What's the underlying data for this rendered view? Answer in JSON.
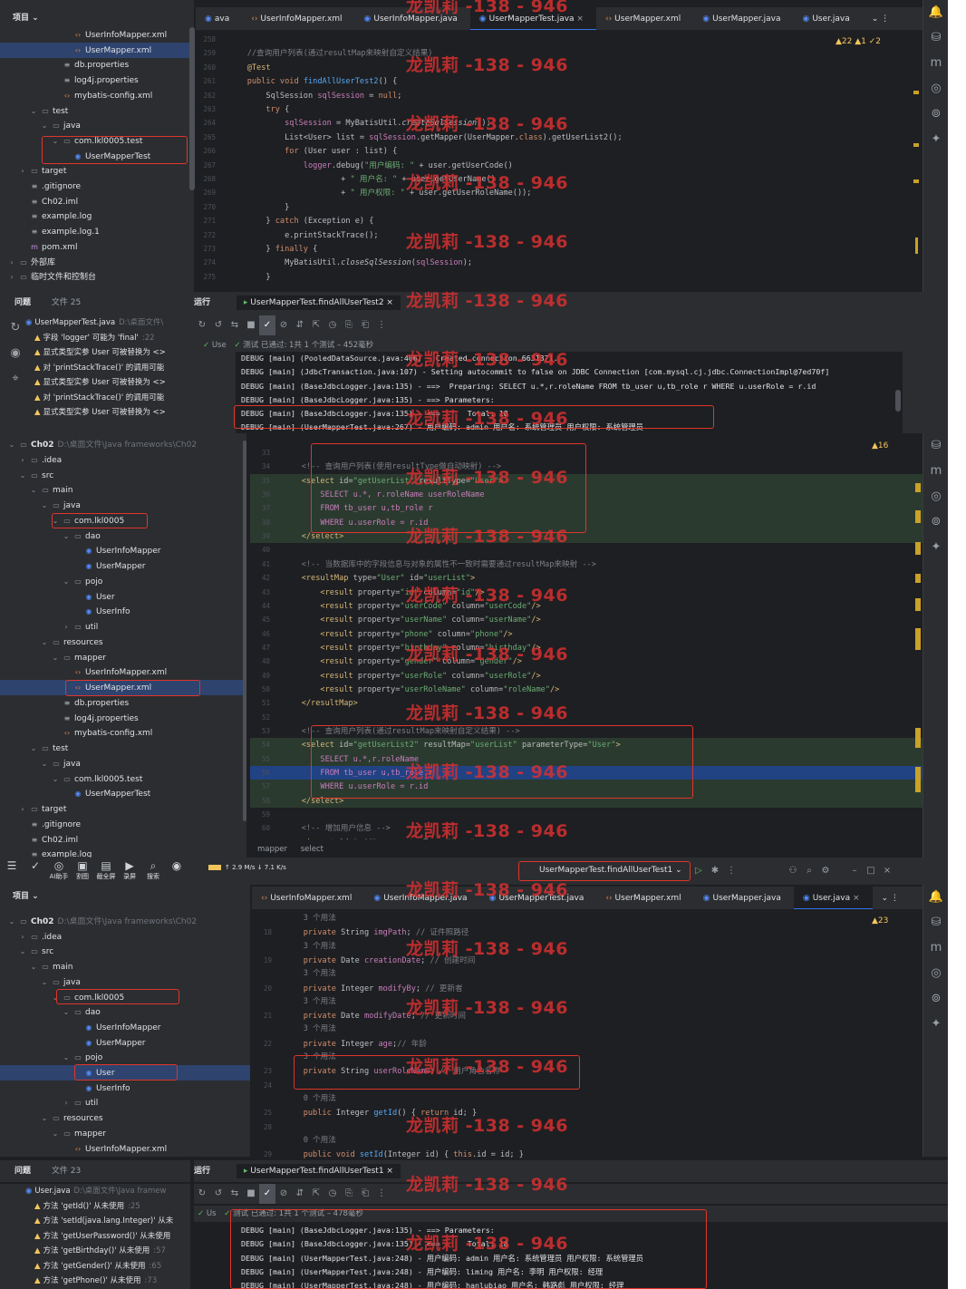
{
  "watermark": "龙凯莉 -138 - 946",
  "warnings_count_a": "▲22 ▲1 ✓2",
  "warnings_count_b": "▲16",
  "warnings_count_c": "▲23",
  "shot1": {
    "tree": [
      {
        "t": "UserInfoMapper.xml",
        "i": "xml",
        "d": 5
      },
      {
        "t": "UserMapper.xml",
        "i": "xml",
        "d": 5,
        "sel": true
      },
      {
        "t": "db.properties",
        "i": "prop",
        "d": 4
      },
      {
        "t": "log4j.properties",
        "i": "prop",
        "d": 4
      },
      {
        "t": "mybatis-config.xml",
        "i": "xml",
        "d": 4
      },
      {
        "t": "test",
        "i": "fold",
        "d": 2,
        "arrow": "v"
      },
      {
        "t": "java",
        "i": "fold",
        "d": 3,
        "arrow": "v"
      },
      {
        "t": "com.lkl0005.test",
        "i": "fold",
        "d": 4,
        "arrow": "v"
      },
      {
        "t": "UserMapperTest",
        "i": "java",
        "d": 5
      },
      {
        "t": "target",
        "i": "fold",
        "d": 1,
        "arrow": ">"
      },
      {
        "t": ".gitignore",
        "i": "prop",
        "d": 1
      },
      {
        "t": "Ch02.iml",
        "i": "prop",
        "d": 1
      },
      {
        "t": "example.log",
        "i": "prop",
        "d": 1
      },
      {
        "t": "example.log.1",
        "i": "prop",
        "d": 1
      },
      {
        "t": "pom.xml",
        "i": "mod",
        "d": 1
      },
      {
        "t": "外部库",
        "i": "fold",
        "d": 0,
        "arrow": ">"
      },
      {
        "t": "临时文件和控制台",
        "i": "fold",
        "d": 0,
        "arrow": ">"
      }
    ],
    "tabs": [
      "ava",
      "UserInfoMapper.xml",
      "UserInfoMapper.java",
      "UserMapperTest.java",
      "UserMapper.xml",
      "UserMapper.java",
      "User.java"
    ],
    "active_tab": 3,
    "code": [
      {
        "n": "258",
        "h": ""
      },
      {
        "n": "259",
        "h": "    <span class='cm'>//查询用户列表(通过resultMap来映射自定义结果)</span>"
      },
      {
        "n": "260",
        "h": "    <span class='tagc'>@Test</span>"
      },
      {
        "n": "261",
        "h": "    <span class='kw'>public void</span> <span class='fn'>findAllUserTest2</span>() {"
      },
      {
        "n": "262",
        "h": "        SqlSession <span class='pu'>sqlSession</span> = <span class='kw'>null</span>;"
      },
      {
        "n": "263",
        "h": "        <span class='kw'>try</span> {"
      },
      {
        "n": "264",
        "h": "            <span class='pu'>sqlSession</span> = MyBatisUtil.<i>createSqlSession</i>();"
      },
      {
        "n": "265",
        "h": "            List&lt;User&gt; list = <span class='pu'>sqlSession</span>.getMapper(UserMapper.<span class='kw'>class</span>).getUserList2();"
      },
      {
        "n": "266",
        "h": "            <span class='kw'>for</span> (User user : list) {"
      },
      {
        "n": "267",
        "h": "                <span class='pu'>logger</span>.debug(<span class='st'>\"用户编码: \"</span> + user.getUserCode()"
      },
      {
        "n": "268",
        "h": "                        + <span class='st'>\" 用户名: \"</span> + user.getUserName()"
      },
      {
        "n": "269",
        "h": "                        + <span class='st'>\" 用户权限: \"</span> + user.getUserRoleName());"
      },
      {
        "n": "270",
        "h": "            }"
      },
      {
        "n": "271",
        "h": "        } <span class='kw'>catch</span> (Exception e) {"
      },
      {
        "n": "272",
        "h": "            e.printStackTrace();"
      },
      {
        "n": "273",
        "h": "        } <span class='kw'>finally</span> {"
      },
      {
        "n": "274",
        "h": "            MyBatisUtil.<i>closeSqlSession</i>(<span class='pu'>sqlSession</span>);"
      },
      {
        "n": "275",
        "h": "        }"
      }
    ],
    "problems_title": "问题",
    "problems_file": "文件 25",
    "run_title": "运行",
    "run_tab": "UserMapperTest.findAllUserTest2",
    "problems": [
      {
        "t": "UserMapperTest.java",
        "dim": "D:\\桌面文件\\",
        "file": true
      },
      {
        "t": "字段 'logger' 可能为 'final'",
        "dim": ":22"
      },
      {
        "t": "显式类型实参 User 可被替换为 <>"
      },
      {
        "t": "对 'printStackTrace()' 的调用可能"
      },
      {
        "t": "显式类型实参 User 可被替换为 <>"
      },
      {
        "t": "对 'printStackTrace()' 的调用可能"
      },
      {
        "t": "显式类型实参 User 可被替换为 <>"
      }
    ],
    "test_pass": "测试 已通过: 1共 1 个测试 – 452毫秒",
    "test_node": "Use",
    "log": [
      "DEBUG [main] (PooledDataSource.java:406) - Created connection 6631371.",
      "DEBUG [main] (JdbcTransaction.java:107) - Setting autocommit to false on JDBC Connection [com.mysql.cj.jdbc.ConnectionImpl@7ed70f]",
      "DEBUG [main] (BaseJdbcLogger.java:135) - ==>  Preparing: SELECT u.*,r.roleName FROM tb_user u,tb_role r WHERE u.userRole = r.id",
      "DEBUG [main] (BaseJdbcLogger.java:135) - ==> Parameters:",
      "DEBUG [main] (BaseJdbcLogger.java:135) - <==      Total: 18",
      "DEBUG [main] (UserMapperTest.java:267) - 用户编码: admin 用户名: 系统管理员 用户权限: 系统管理员"
    ]
  },
  "shot2": {
    "tree": [
      {
        "t": "Ch02",
        "i": "fold",
        "d": 0,
        "arrow": "v",
        "dim": "D:\\桌面文件\\Java frameworks\\Ch02",
        "bold": true
      },
      {
        "t": ".idea",
        "i": "fold",
        "d": 1,
        "arrow": ">"
      },
      {
        "t": "src",
        "i": "fold",
        "d": 1,
        "arrow": "v"
      },
      {
        "t": "main",
        "i": "fold",
        "d": 2,
        "arrow": "v"
      },
      {
        "t": "java",
        "i": "fold",
        "d": 3,
        "arrow": "v"
      },
      {
        "t": "com.lkl0005",
        "i": "fold",
        "d": 4,
        "arrow": "v"
      },
      {
        "t": "dao",
        "i": "fold",
        "d": 5,
        "arrow": "v"
      },
      {
        "t": "UserInfoMapper",
        "i": "java",
        "d": 6
      },
      {
        "t": "UserMapper",
        "i": "java",
        "d": 6
      },
      {
        "t": "pojo",
        "i": "fold",
        "d": 5,
        "arrow": "v"
      },
      {
        "t": "User",
        "i": "java",
        "d": 6
      },
      {
        "t": "UserInfo",
        "i": "java",
        "d": 6
      },
      {
        "t": "util",
        "i": "fold",
        "d": 5,
        "arrow": ">"
      },
      {
        "t": "resources",
        "i": "fold",
        "d": 3,
        "arrow": "v"
      },
      {
        "t": "mapper",
        "i": "fold",
        "d": 4,
        "arrow": "v"
      },
      {
        "t": "UserInfoMapper.xml",
        "i": "xml",
        "d": 5
      },
      {
        "t": "UserMapper.xml",
        "i": "xml",
        "d": 5,
        "sel": true
      },
      {
        "t": "db.properties",
        "i": "prop",
        "d": 4
      },
      {
        "t": "log4j.properties",
        "i": "prop",
        "d": 4
      },
      {
        "t": "mybatis-config.xml",
        "i": "xml",
        "d": 4
      },
      {
        "t": "test",
        "i": "fold",
        "d": 2,
        "arrow": "v"
      },
      {
        "t": "java",
        "i": "fold",
        "d": 3,
        "arrow": "v"
      },
      {
        "t": "com.lkl0005.test",
        "i": "fold",
        "d": 4,
        "arrow": "v"
      },
      {
        "t": "UserMapperTest",
        "i": "java",
        "d": 5
      },
      {
        "t": "target",
        "i": "fold",
        "d": 1,
        "arrow": ">"
      },
      {
        "t": ".gitignore",
        "i": "prop",
        "d": 1
      },
      {
        "t": "Ch02.iml",
        "i": "prop",
        "d": 1
      },
      {
        "t": "example.log",
        "i": "prop",
        "d": 1
      }
    ],
    "code": [
      {
        "n": "33",
        "h": ""
      },
      {
        "n": "34",
        "h": "    <span class='cm'>&lt;!-- 查询用户列表(使用resultType做自动映射) --&gt;</span>"
      },
      {
        "n": "35",
        "h": "    <span class='tagc'>&lt;select</span> <span class='at'>id=</span><span class='vl'>\"getUserList\"</span> <span class='at'>resultType=</span><span class='vl'>\"User\"</span><span class='tagc'>&gt;</span>",
        "tg": true
      },
      {
        "n": "36",
        "h": "        <span class='pu'>SELECT u.*, r.roleName userRoleName</span>",
        "tg": true
      },
      {
        "n": "37",
        "h": "        <span class='pu'>FROM tb_user u,tb_role r</span>",
        "tg": true
      },
      {
        "n": "38",
        "h": "        <span class='pu'>WHERE u.userRole = r.id</span>",
        "tg": true
      },
      {
        "n": "39",
        "h": "    <span class='tagc'>&lt;/select&gt;</span>",
        "tg": true
      },
      {
        "n": "40",
        "h": ""
      },
      {
        "n": "41",
        "h": "    <span class='cm'>&lt;!-- 当数据库中的字段信息与对象的属性不一致时需要通过resultMap来映射 --&gt;</span>"
      },
      {
        "n": "42",
        "h": "    <span class='tagc'>&lt;resultMap</span> <span class='at'>type=</span><span class='vl'>\"User\"</span> <span class='at'>id=</span><span class='vl'>\"userList\"</span><span class='tagc'>&gt;</span>"
      },
      {
        "n": "43",
        "h": "        <span class='tagc'>&lt;result</span> <span class='at'>property=</span><span class='vl'>\"id\"</span> <span class='at'>column=</span><span class='vl'>\"id\"</span><span class='tagc'>/&gt;</span>"
      },
      {
        "n": "44",
        "h": "        <span class='tagc'>&lt;result</span> <span class='at'>property=</span><span class='vl'>\"userCode\"</span> <span class='at'>column=</span><span class='vl'>\"userCode\"</span><span class='tagc'>/&gt;</span>"
      },
      {
        "n": "45",
        "h": "        <span class='tagc'>&lt;result</span> <span class='at'>property=</span><span class='vl'>\"userName\"</span> <span class='at'>column=</span><span class='vl'>\"userName\"</span><span class='tagc'>/&gt;</span>"
      },
      {
        "n": "46",
        "h": "        <span class='tagc'>&lt;result</span> <span class='at'>property=</span><span class='vl'>\"phone\"</span> <span class='at'>column=</span><span class='vl'>\"phone\"</span><span class='tagc'>/&gt;</span>"
      },
      {
        "n": "47",
        "h": "        <span class='tagc'>&lt;result</span> <span class='at'>property=</span><span class='vl'>\"birthday\"</span> <span class='at'>column=</span><span class='vl'>\"birthday\"</span><span class='tagc'>/&gt;</span>"
      },
      {
        "n": "48",
        "h": "        <span class='tagc'>&lt;result</span> <span class='at'>property=</span><span class='vl'>\"gender\"</span> <span class='at'>column=</span><span class='vl'>\"gender\"</span><span class='tagc'>/&gt;</span>"
      },
      {
        "n": "49",
        "h": "        <span class='tagc'>&lt;result</span> <span class='at'>property=</span><span class='vl'>\"userRole\"</span> <span class='at'>column=</span><span class='vl'>\"userRole\"</span><span class='tagc'>/&gt;</span>"
      },
      {
        "n": "50",
        "h": "        <span class='tagc'>&lt;result</span> <span class='at'>property=</span><span class='vl'>\"userRoleName\"</span> <span class='at'>column=</span><span class='vl'>\"roleName\"</span><span class='tagc'>/&gt;</span>"
      },
      {
        "n": "51",
        "h": "    <span class='tagc'>&lt;/resultMap&gt;</span>"
      },
      {
        "n": "52",
        "h": ""
      },
      {
        "n": "53",
        "h": "    <span class='cm'>&lt;!-- 查询用户列表(通过resultMap来映射自定义结果) --&gt;</span>"
      },
      {
        "n": "54",
        "h": "    <span class='tagc'>&lt;select</span> <span class='at'>id=</span><span class='vl'>\"getUserList2\"</span> <span class='at'>resultMap=</span><span class='vl'>\"userList\"</span> <span class='at'>parameterType=</span><span class='vl'>\"User\"</span><span class='tagc'>&gt;</span>",
        "tg": true
      },
      {
        "n": "55",
        "h": "        <span class='pu'>SELECT u.*,r.roleName</span>",
        "tg": true
      },
      {
        "n": "56",
        "h": "        <span class='pu'>FROM tb_user u,tb_role r</span>",
        "hl": true
      },
      {
        "n": "57",
        "h": "        <span class='pu'>WHERE u.userRole = r.id</span>",
        "tg": true
      },
      {
        "n": "58",
        "h": "    <span class='tagc'>&lt;/select&gt;</span>",
        "tg": true
      },
      {
        "n": "59",
        "h": ""
      },
      {
        "n": "60",
        "h": "    <span class='cm'>&lt;!-- 增加用户信息 --&gt;</span>"
      },
      {
        "n": "61",
        "h": "    <span class='tagc'>&lt;insert</span> <span class='at'>id=</span><span class='vl'>\"add\"</span> <span class='at'>parameterType=</span><span class='vl'>\"User\"</span><span class='tagc'>&gt;</span>"
      }
    ],
    "breadcrumb": [
      "mapper",
      "select"
    ]
  },
  "shot3": {
    "main_menu": [
      {
        "i": "☰",
        "t": ""
      },
      {
        "i": "✓",
        "t": ""
      },
      {
        "i": "◎",
        "t": "AI助手"
      },
      {
        "i": "▣",
        "t": "割图"
      },
      {
        "i": "▤",
        "t": "截全屏"
      },
      {
        "i": "▶",
        "t": "录屏"
      },
      {
        "i": "⌕",
        "t": "搜索"
      },
      {
        "i": "◉",
        "t": ""
      }
    ],
    "net_speed": "↑ 2.9 M/s  ↓ 7.1  K/s",
    "run_config": "UserMapperTest.findAllUserTest1",
    "tree": [
      {
        "t": "Ch02",
        "i": "fold",
        "d": 0,
        "arrow": "v",
        "dim": "D:\\桌面文件\\Java frameworks\\Ch02",
        "bold": true
      },
      {
        "t": ".idea",
        "i": "fold",
        "d": 1,
        "arrow": ">"
      },
      {
        "t": "src",
        "i": "fold",
        "d": 1,
        "arrow": "v"
      },
      {
        "t": "main",
        "i": "fold",
        "d": 2,
        "arrow": "v"
      },
      {
        "t": "java",
        "i": "fold",
        "d": 3,
        "arrow": "v"
      },
      {
        "t": "com.lkl0005",
        "i": "fold",
        "d": 4,
        "arrow": "v"
      },
      {
        "t": "dao",
        "i": "fold",
        "d": 5,
        "arrow": "v"
      },
      {
        "t": "UserInfoMapper",
        "i": "java",
        "d": 6
      },
      {
        "t": "UserMapper",
        "i": "java",
        "d": 6
      },
      {
        "t": "pojo",
        "i": "fold",
        "d": 5,
        "arrow": "v"
      },
      {
        "t": "User",
        "i": "java",
        "d": 6,
        "sel": true
      },
      {
        "t": "UserInfo",
        "i": "java",
        "d": 6
      },
      {
        "t": "util",
        "i": "fold",
        "d": 5,
        "arrow": ">"
      },
      {
        "t": "resources",
        "i": "fold",
        "d": 3,
        "arrow": "v"
      },
      {
        "t": "mapper",
        "i": "fold",
        "d": 4,
        "arrow": "v"
      },
      {
        "t": "UserInfoMapper.xml",
        "i": "xml",
        "d": 5
      }
    ],
    "tabs": [
      "UserInfoMapper.xml",
      "UserInfoMapper.java",
      "UserMapperTest.java",
      "UserMapper.xml",
      "UserMapper.java",
      "User.java"
    ],
    "active_tab": 5,
    "code": [
      {
        "n": "",
        "h": "    <span class='cm'>3 个用法</span>"
      },
      {
        "n": "18",
        "h": "    <span class='kw'>private</span> String <span class='pu'>imgPath</span>; <span class='cm'>// 证件照路径</span>"
      },
      {
        "n": "",
        "h": "    <span class='cm'>3 个用法</span>"
      },
      {
        "n": "19",
        "h": "    <span class='kw'>private</span> Date <span class='pu'>creationDate</span>; <span class='cm'>// 创建时间</span>"
      },
      {
        "n": "",
        "h": "    <span class='cm'>3 个用法</span>"
      },
      {
        "n": "20",
        "h": "    <span class='kw'>private</span> Integer <span class='pu'>modifyBy</span>; <span class='cm'>// 更新者</span>"
      },
      {
        "n": "",
        "h": "    <span class='cm'>3 个用法</span>"
      },
      {
        "n": "21",
        "h": "    <span class='kw'>private</span> Date <span class='pu'>modifyDate</span>; <span class='cm'>// 更新时间</span>"
      },
      {
        "n": "",
        "h": "    <span class='cm'>3 个用法</span>"
      },
      {
        "n": "22",
        "h": "    <span class='kw'>private</span> Integer <span class='pu'>age</span>;<span class='cm'>// 年龄</span>"
      },
      {
        "n": "",
        "h": "    <span class='cm'>3 个用法</span>"
      },
      {
        "n": "23",
        "h": "    <span class='kw'>private</span> String <span class='pu'>userRoleName</span>; <span class='cm'>// 用户角色名称</span>"
      },
      {
        "n": "24",
        "h": ""
      },
      {
        "n": "",
        "h": "    <span class='cm'>0 个用法</span>"
      },
      {
        "n": "25",
        "h": "    <span class='kw'>public</span> Integer <span class='fn'>getId</span>() { <span class='kw'>return</span> id; }"
      },
      {
        "n": "28",
        "h": ""
      },
      {
        "n": "",
        "h": "    <span class='cm'>0 个用法</span>"
      },
      {
        "n": "29",
        "h": "    <span class='kw'>public void</span> <span class='fn'>setId</span>(Integer id) { <span class='kw'>this</span>.id = id; }"
      }
    ],
    "problems_file": "文件 23",
    "run_tab": "UserMapperTest.findAllUserTest1",
    "problems": [
      {
        "t": "User.java",
        "dim": "D:\\桌面文件\\Java framew",
        "file": true
      },
      {
        "t": "方法 'getId()' 从未使用",
        "dim": ":25"
      },
      {
        "t": "方法 'setId(java.lang.Integer)' 从未"
      },
      {
        "t": "方法 'getUserPassword()' 从未使用"
      },
      {
        "t": "方法 'getBirthday()' 从未使用",
        "dim": ":57"
      },
      {
        "t": "方法 'getGender()' 从未使用",
        "dim": ":65"
      },
      {
        "t": "方法 'getPhone()' 从未使用",
        "dim": ":73"
      }
    ],
    "test_pass": "测试 已通过: 1共 1 个测试 – 478毫秒",
    "test_node": "Us",
    "log": [
      "DEBUG [main] (BaseJdbcLogger.java:135) - ==> Parameters:",
      "DEBUG [main] (BaseJdbcLogger.java:135) - <==      Total: 18",
      "DEBUG [main] (UserMapperTest.java:248) - 用户编码: admin 用户名: 系统管理员 用户权限: 系统管理员",
      "DEBUG [main] (UserMapperTest.java:248) - 用户编码: liming 用户名: 李明 用户权限: 经理",
      "DEBUG [main] (UserMapperTest.java:248) - 用户编码: hanlubiao 用户名: 韩路彪 用户权限: 经理"
    ]
  },
  "labels": {
    "project": "项目",
    "problems": "问题",
    "run": "运行"
  }
}
